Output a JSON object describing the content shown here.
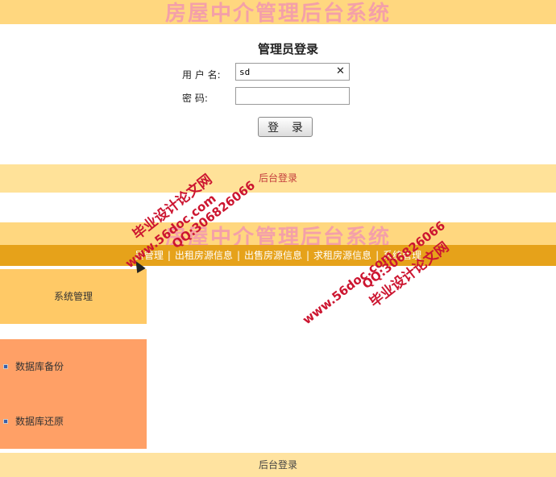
{
  "header": {
    "title": "房屋中介管理后台系统"
  },
  "login": {
    "title": "管理员登录",
    "username_label": "用 户 名:",
    "username_value": "sd",
    "password_label": "密    码:",
    "submit_label": "登 录"
  },
  "footer": {
    "text": "后台登录"
  },
  "nav": {
    "items": [
      {
        "label": "员管理"
      },
      {
        "label": "出租房源信息"
      },
      {
        "label": "出售房源信息"
      },
      {
        "label": "求租房源信息"
      },
      {
        "label": "系统管理"
      }
    ]
  },
  "sidebar": {
    "heading": "系统管理",
    "items": [
      {
        "label": "数据库备份"
      },
      {
        "label": "数据库还原"
      }
    ]
  },
  "watermark": {
    "site": "www.56doc.com",
    "qq": "QQ:306826066",
    "brand": "毕业设计论文网"
  }
}
